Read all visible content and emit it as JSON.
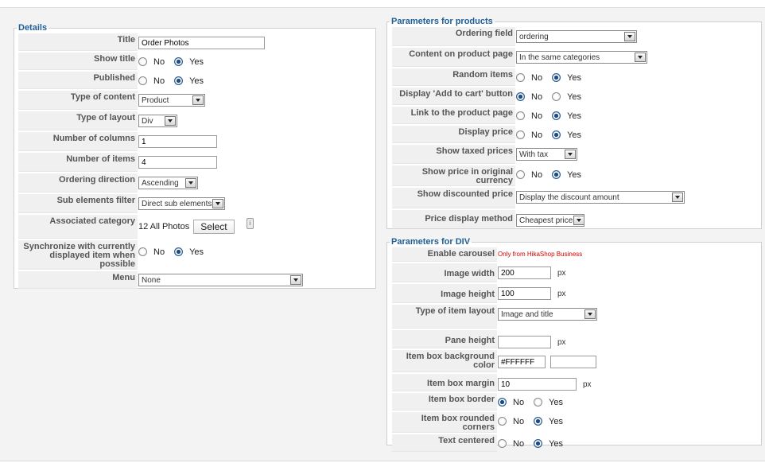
{
  "details": {
    "legend": "Details",
    "title": {
      "label": "Title",
      "value": "Order Photos"
    },
    "show_title": {
      "label": "Show title",
      "no": "No",
      "yes": "Yes",
      "selected": "Yes"
    },
    "published": {
      "label": "Published",
      "no": "No",
      "yes": "Yes",
      "selected": "Yes"
    },
    "type_of_content": {
      "label": "Type of content",
      "value": "Product"
    },
    "type_of_layout": {
      "label": "Type of layout",
      "value": "Div"
    },
    "number_of_columns": {
      "label": "Number of columns",
      "value": "1"
    },
    "number_of_items": {
      "label": "Number of items",
      "value": "4"
    },
    "ordering_direction": {
      "label": "Ordering direction",
      "value": "Ascending"
    },
    "sub_elements_filter": {
      "label": "Sub elements filter",
      "value": "Direct sub elements"
    },
    "associated_category": {
      "label": "Associated category",
      "value": "12 All Photos",
      "button": "Select"
    },
    "synchronize": {
      "label": "Synchronize with currently displayed item when possible",
      "no": "No",
      "yes": "Yes",
      "selected": "Yes"
    },
    "menu": {
      "label": "Menu",
      "value": "None"
    }
  },
  "products": {
    "legend": "Parameters for products",
    "ordering_field": {
      "label": "Ordering field",
      "value": "ordering"
    },
    "content_on_product_page": {
      "label": "Content on product page",
      "value": "In the same categories"
    },
    "random_items": {
      "label": "Random items",
      "no": "No",
      "yes": "Yes",
      "selected": "Yes"
    },
    "display_add_to_cart": {
      "label": "Display 'Add to cart' button",
      "no": "No",
      "yes": "Yes",
      "selected": "No"
    },
    "link_to_product_page": {
      "label": "Link to the product page",
      "no": "No",
      "yes": "Yes",
      "selected": "Yes"
    },
    "display_price": {
      "label": "Display price",
      "no": "No",
      "yes": "Yes",
      "selected": "Yes"
    },
    "show_taxed_prices": {
      "label": "Show taxed prices",
      "value": "With tax"
    },
    "show_price_original_currency": {
      "label": "Show price in original currency",
      "no": "No",
      "yes": "Yes",
      "selected": "Yes"
    },
    "show_discounted_price": {
      "label": "Show discounted price",
      "value": "Display the discount amount"
    },
    "price_display_method": {
      "label": "Price display method",
      "value": "Cheapest price"
    }
  },
  "div": {
    "legend": "Parameters for DIV",
    "enable_carousel": {
      "label": "Enable carousel",
      "note": "Only from HikaShop Business"
    },
    "image_width": {
      "label": "Image width",
      "value": "200",
      "unit": "px"
    },
    "image_height": {
      "label": "Image height",
      "value": "100",
      "unit": "px"
    },
    "type_of_item_layout": {
      "label": "Type of item layout",
      "value": "Image and title"
    },
    "pane_height": {
      "label": "Pane height",
      "value": "",
      "unit": "px"
    },
    "item_box_background_color": {
      "label": "Item box background color",
      "value": "#FFFFFF"
    },
    "item_box_margin": {
      "label": "Item box margin",
      "value": "10",
      "unit": "px"
    },
    "item_box_border": {
      "label": "Item box border",
      "no": "No",
      "yes": "Yes",
      "selected": "No"
    },
    "item_box_rounded_corners": {
      "label": "Item box rounded corners",
      "no": "No",
      "yes": "Yes",
      "selected": "Yes"
    },
    "text_centered": {
      "label": "Text centered",
      "no": "No",
      "yes": "Yes",
      "selected": "Yes"
    }
  }
}
